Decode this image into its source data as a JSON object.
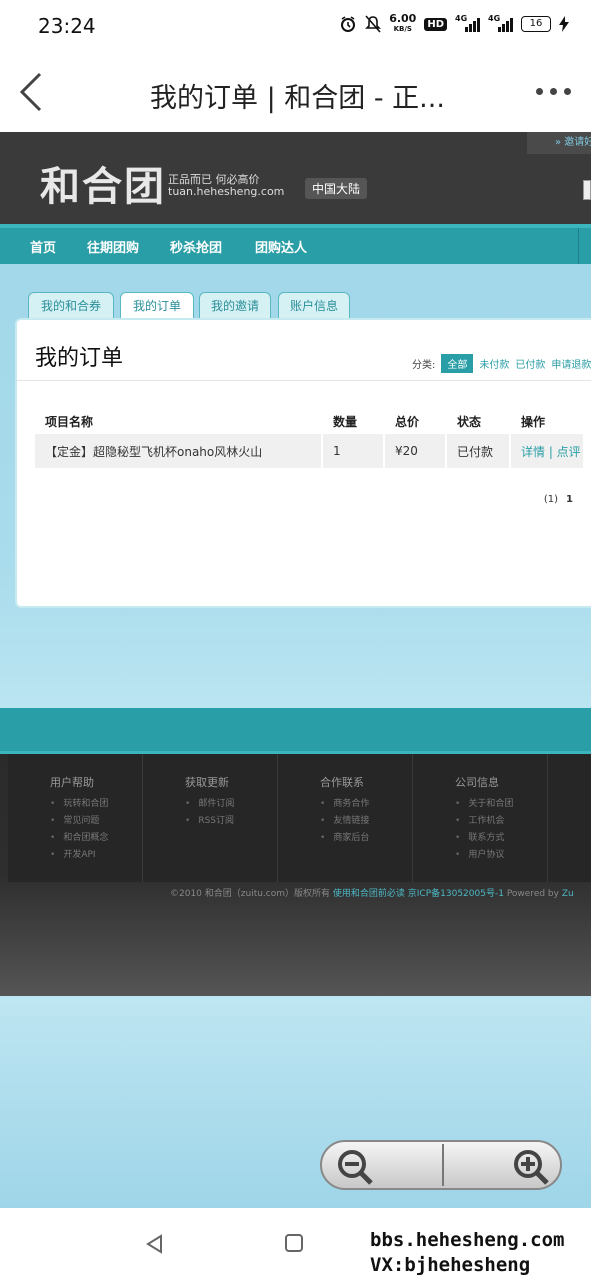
{
  "status_bar": {
    "time": "23:24",
    "net_speed": "6.00",
    "net_unit": "KB/S",
    "hd": "HD",
    "signal1": "4G",
    "signal2": "4G",
    "battery": "16"
  },
  "browser": {
    "title": "我的订单 | 和合团 - 正..."
  },
  "site": {
    "invite": "» 邀请好",
    "logo": "和合团",
    "slogan": "正品而已 何必高价",
    "domain": "tuan.hehesheng.com",
    "city": "中国大陆",
    "nav": [
      "首页",
      "往期团购",
      "秒杀抢团",
      "团购达人"
    ]
  },
  "tabs": [
    "我的和合券",
    "我的订单",
    "我的邀请",
    "账户信息"
  ],
  "panel": {
    "title": "我的订单",
    "filter_label": "分类:",
    "filters": [
      "全部",
      "未付款",
      "已付款",
      "申请退款"
    ]
  },
  "table": {
    "headers": [
      "项目名称",
      "数量",
      "总价",
      "状态",
      "操作"
    ],
    "rows": [
      {
        "name": "【定金】超隐秘型飞机杯onaho风林火山",
        "qty": "1",
        "price": "¥20",
        "status": "已付款",
        "ops": "详情 | 点评"
      }
    ]
  },
  "pager": {
    "count": "(1)",
    "page": "1"
  },
  "footer": {
    "columns": [
      {
        "title": "用户帮助",
        "items": [
          "玩转和合团",
          "常见问题",
          "和合团概念",
          "开发API"
        ]
      },
      {
        "title": "获取更新",
        "items": [
          "邮件订阅",
          "RSS订阅"
        ]
      },
      {
        "title": "合作联系",
        "items": [
          "商务合作",
          "友情链接",
          "商家后台"
        ]
      },
      {
        "title": "公司信息",
        "items": [
          "关于和合团",
          "工作机会",
          "联系方式",
          "用户协议"
        ]
      }
    ],
    "copyright": "©2010 和合团（zuitu.com）版权所有",
    "copyright_link1": "使用和合团前必读",
    "copyright_link2": "京ICP备13052005号-1",
    "powered": "Powered by",
    "powered_link": "Zu"
  },
  "watermark": {
    "line1": "bbs.hehesheng.com",
    "line2": "VX:bjhehesheng"
  }
}
